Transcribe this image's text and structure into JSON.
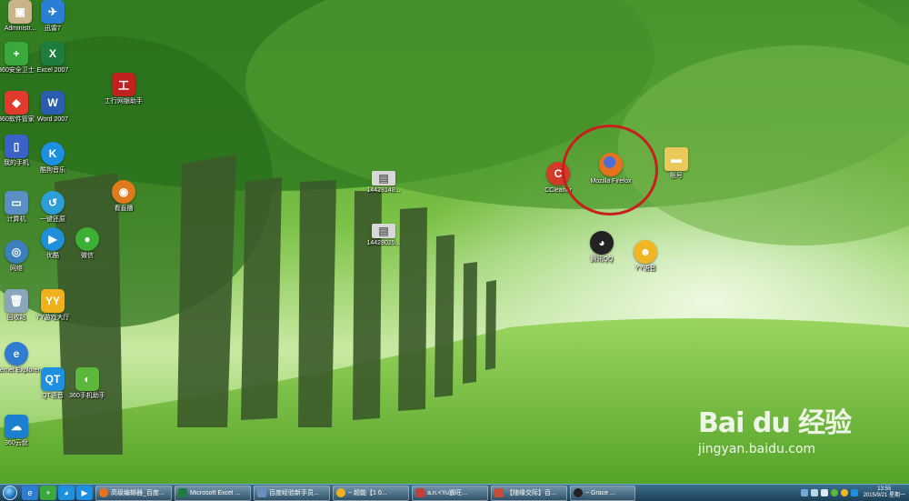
{
  "desktop": {
    "icons": [
      {
        "key": "admin",
        "label": "Administr...",
        "color": "#c9b48a"
      },
      {
        "key": "xunlei",
        "label": "迅雷7",
        "color": "#2a7fd4"
      },
      {
        "key": "360safe",
        "label": "360安全卫士",
        "color": "#3aa83a"
      },
      {
        "key": "excel",
        "label": "Excel 2007",
        "color": "#1e7d3e"
      },
      {
        "key": "icbc",
        "label": "工行网银助手",
        "color": "#c0221f"
      },
      {
        "key": "360soft",
        "label": "360软件管家",
        "color": "#e23b2e"
      },
      {
        "key": "word",
        "label": "Word 2007",
        "color": "#2a5db0"
      },
      {
        "key": "myphone",
        "label": "我的手机",
        "color": "#3d62c7"
      },
      {
        "key": "kugou",
        "label": "酷狗音乐",
        "color": "#1c8fe0"
      },
      {
        "key": "kanzhibo",
        "label": "看直播",
        "color": "#e07b1c"
      },
      {
        "key": "computer",
        "label": "计算机",
        "color": "#5a8fc2"
      },
      {
        "key": "onekey",
        "label": "一键还原",
        "color": "#2d9ed8"
      },
      {
        "key": "network",
        "label": "网络",
        "color": "#3c7fbf"
      },
      {
        "key": "youku",
        "label": "优酷",
        "color": "#1e8fd8"
      },
      {
        "key": "wechat",
        "label": "微信",
        "color": "#3cb034"
      },
      {
        "key": "recycle",
        "label": "回收站",
        "color": "#8aa6bb"
      },
      {
        "key": "yygame",
        "label": "YY游戏大厅",
        "color": "#f0b21c"
      },
      {
        "key": "ie",
        "label": "Internet Explorer",
        "color": "#2f7cd0"
      },
      {
        "key": "qtvoice",
        "label": "QT语音",
        "color": "#1e90dd"
      },
      {
        "key": "360mobile",
        "label": "360手机助手",
        "color": "#5cb83a"
      },
      {
        "key": "360cloud",
        "label": "360云盘",
        "color": "#1d7fd0"
      },
      {
        "key": "file1",
        "label": "14428148...",
        "color": "#d8d8d8"
      },
      {
        "key": "file2",
        "label": "14428025...",
        "color": "#d8d8d8"
      },
      {
        "key": "ccleaner",
        "label": "CCleaner",
        "color": "#d23a2a"
      },
      {
        "key": "firefox",
        "label": "Mozilla Firefox",
        "color": "#e8711c"
      },
      {
        "key": "account",
        "label": "账号",
        "color": "#e9c95a"
      },
      {
        "key": "tencentqq",
        "label": "腾讯QQ",
        "color": "#222"
      },
      {
        "key": "yyvoice",
        "label": "YY语音",
        "color": "#f1b623"
      }
    ]
  },
  "watermark": {
    "brand": "Bai du 经验",
    "url": "jingyan.baidu.com"
  },
  "taskbar": {
    "pinned": [
      {
        "key": "ie",
        "color": "#2f7cd0"
      },
      {
        "key": "360",
        "color": "#3aa83a"
      },
      {
        "key": "qq",
        "color": "#1e90dd"
      },
      {
        "key": "youku",
        "color": "#1c8fe0"
      }
    ],
    "tasks": [
      {
        "label": "高级编辑器_百度...",
        "color": "#e8711c"
      },
      {
        "label": "Microsoft Excel ...",
        "color": "#1e7d3e"
      },
      {
        "label": "百度经验新手员...",
        "color": "#6a8fbf"
      },
      {
        "label": "~ 超能【1 0...",
        "color": "#f0b21c"
      },
      {
        "label": "a.n.<Yu霸旺...",
        "color": "#c0403a"
      },
      {
        "label": "【随缘交际】百...",
        "color": "#c94a3a"
      },
      {
        "label": "~ Grace ...",
        "color": "#222"
      }
    ],
    "clock": {
      "time": "13:55",
      "date": "2015/9/21 星期一"
    }
  }
}
